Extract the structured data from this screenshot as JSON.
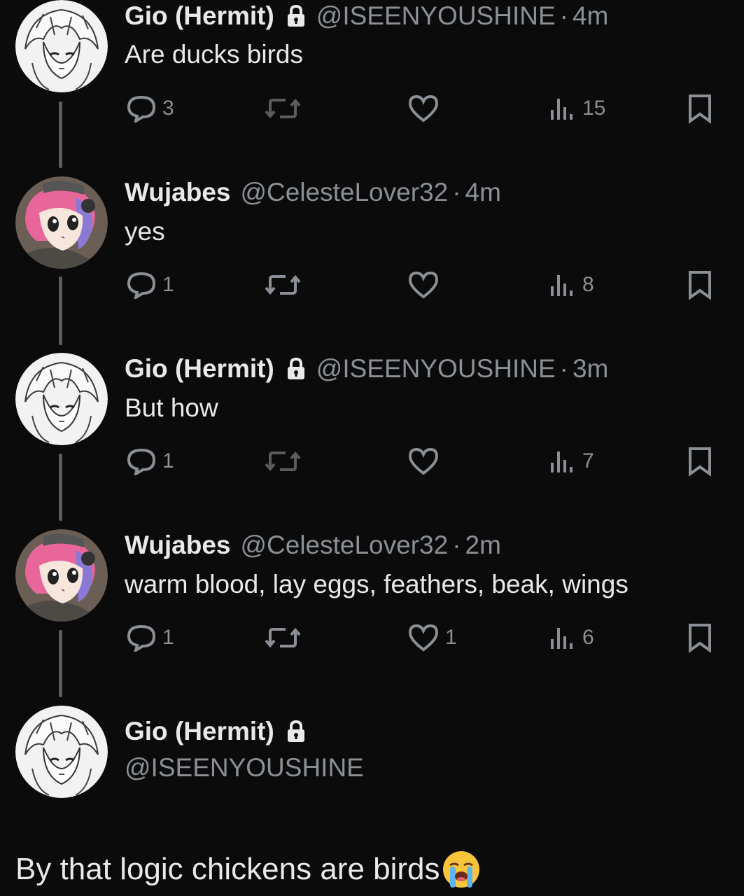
{
  "users": {
    "gio": {
      "display_name": "Gio (Hermit)",
      "handle": "@ISEENYOUSHINE",
      "avatar": "anime-avatar-white-hair",
      "locked_icon": "lock-icon"
    },
    "wujabes": {
      "display_name": "Wujabes",
      "handle": "@CelesteLover32",
      "avatar": "anime-avatar-pink-hair"
    }
  },
  "tweets": [
    {
      "display_name": "Gio (Hermit)",
      "handle": "@ISEENYOUSHINE",
      "separator": "·",
      "time": "4m",
      "text": "Are ducks birds",
      "replies": "3",
      "retweets": "",
      "likes": "",
      "views": "15"
    },
    {
      "display_name": "Wujabes",
      "handle": "@CelesteLover32",
      "separator": "·",
      "time": "4m",
      "text": "yes",
      "replies": "1",
      "retweets": "",
      "likes": "",
      "views": "8"
    },
    {
      "display_name": "Gio (Hermit)",
      "handle": "@ISEENYOUSHINE",
      "separator": "·",
      "time": "3m",
      "text": "But how",
      "replies": "1",
      "retweets": "",
      "likes": "",
      "views": "7"
    },
    {
      "display_name": "Wujabes",
      "handle": "@CelesteLover32",
      "separator": "·",
      "time": "2m",
      "text": "warm blood, lay eggs, feathers, beak, wings",
      "replies": "1",
      "retweets": "",
      "likes": "1",
      "views": "6"
    }
  ],
  "focused_tweet": {
    "display_name": "Gio (Hermit)",
    "handle": "@ISEENYOUSHINE",
    "text": "By that logic chickens are birds",
    "emoji": "loudly-crying-face-icon"
  },
  "colors": {
    "background": "#0b0b0b",
    "text": "#e7e9ea",
    "muted": "#8b9096",
    "thread_line": "#5a5d60"
  }
}
